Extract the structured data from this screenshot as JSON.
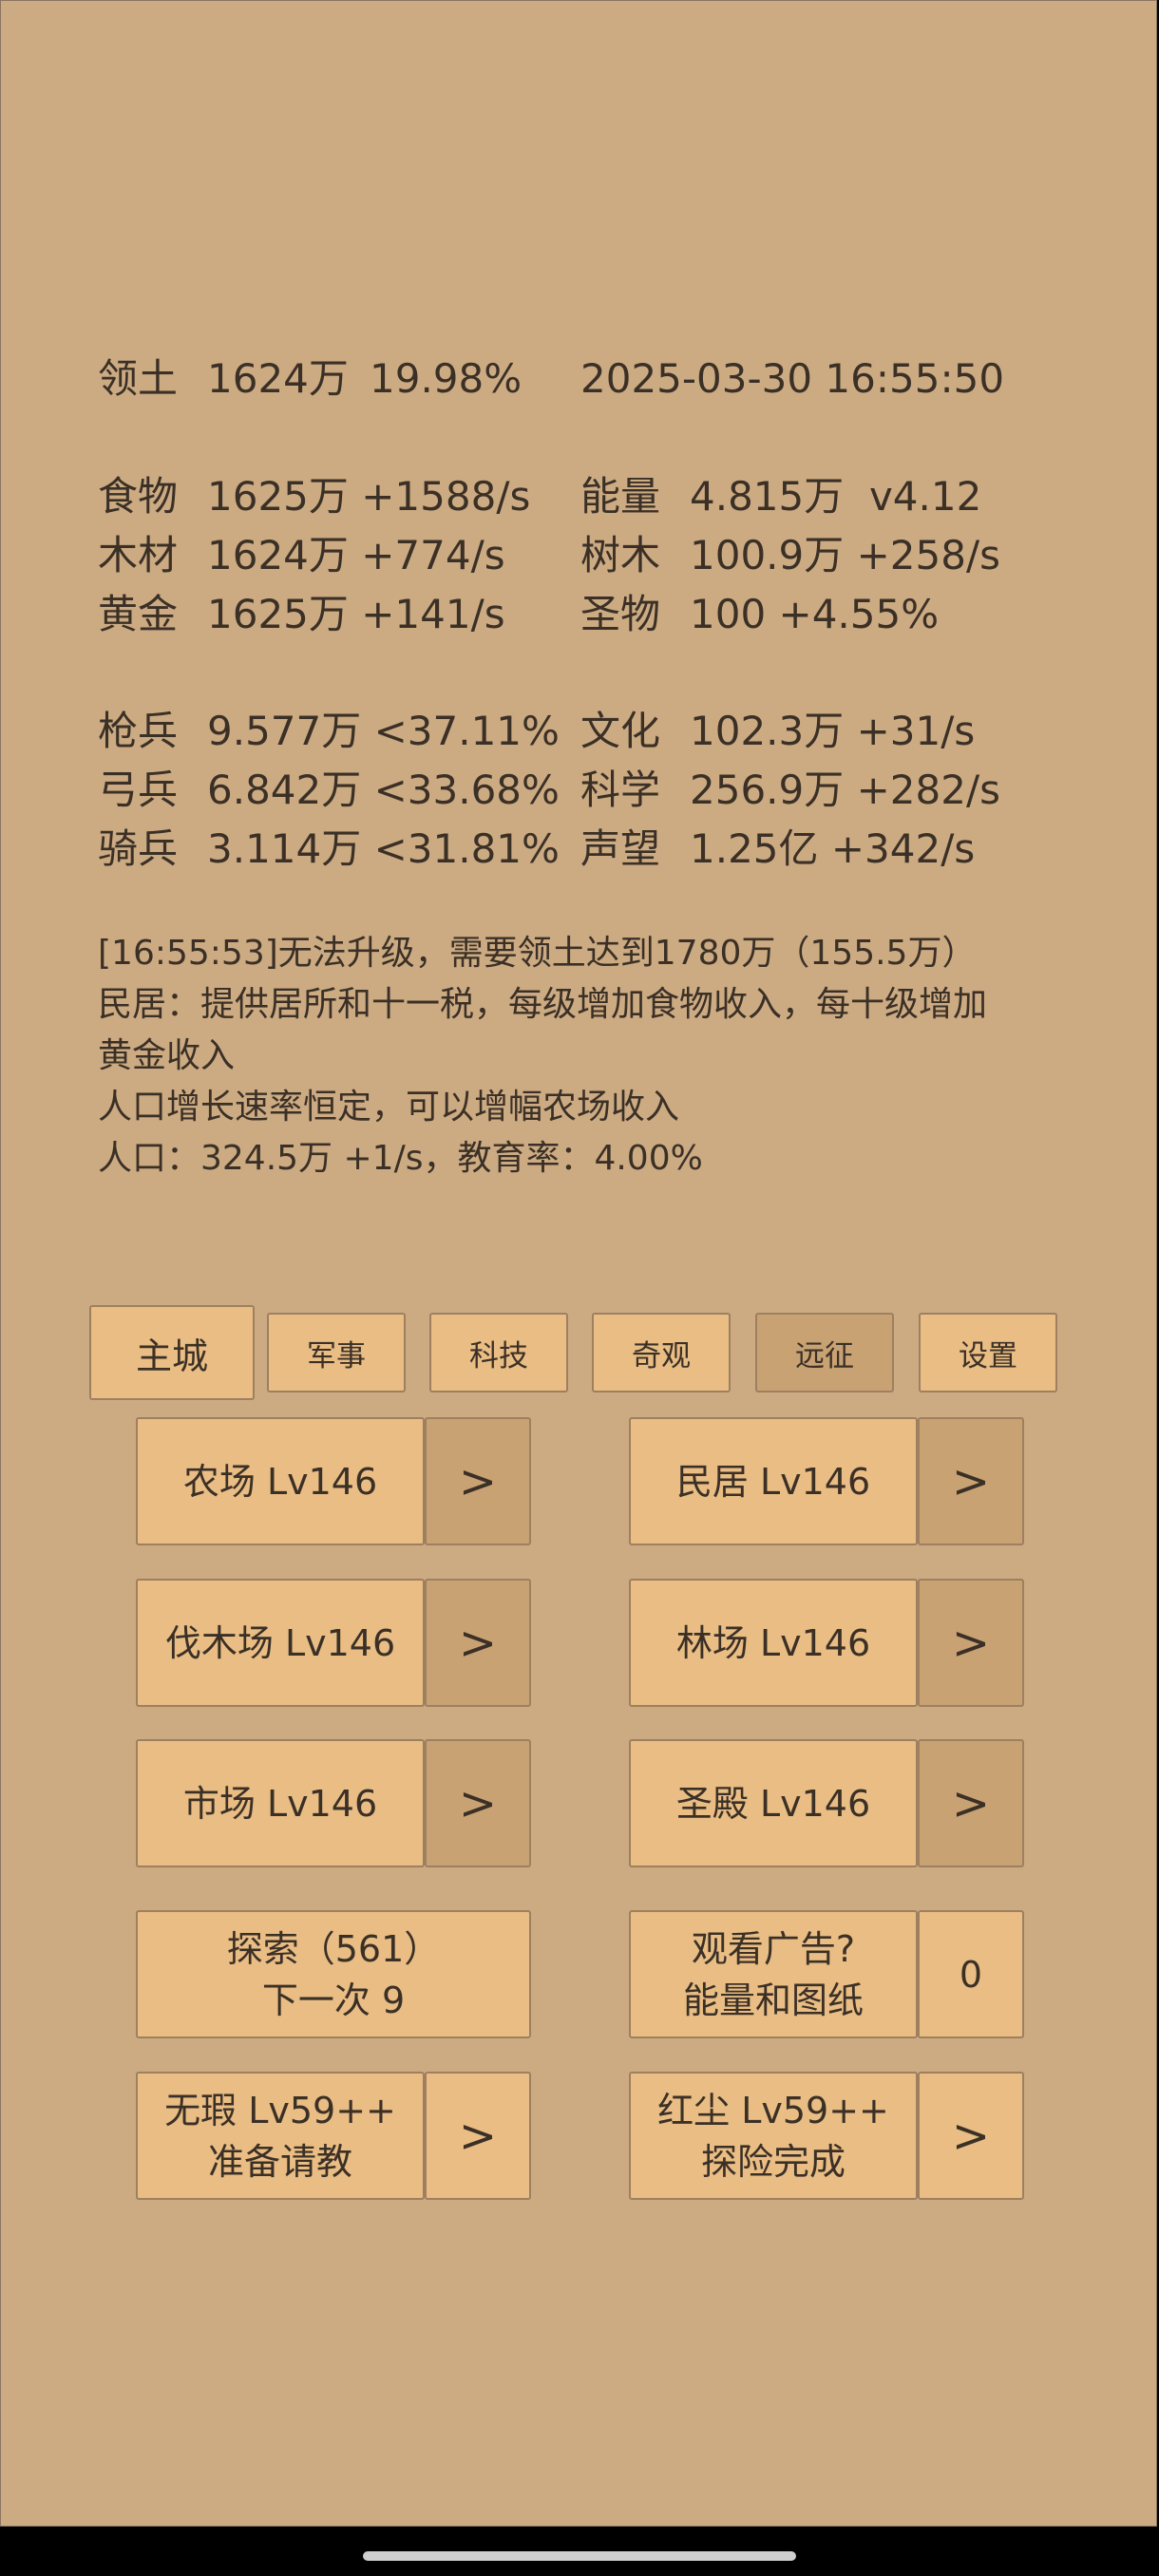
{
  "header": {
    "territory_label": "领土",
    "territory_value": "1624万",
    "territory_pct": "19.98%",
    "datetime": "2025-03-30 16:55:50"
  },
  "resources": {
    "food": {
      "label": "食物",
      "value": "1625万 +1588/s"
    },
    "wood": {
      "label": "木材",
      "value": "1624万 +774/s"
    },
    "gold": {
      "label": "黄金",
      "value": "1625万 +141/s"
    },
    "energy": {
      "label": "能量",
      "value": "4.815万  v4.12"
    },
    "trees": {
      "label": "树木",
      "value": "100.9万 +258/s"
    },
    "relic": {
      "label": "圣物",
      "value": "100 +4.55%"
    }
  },
  "military": {
    "spear": {
      "label": "枪兵",
      "value": "9.577万 <37.11%"
    },
    "archer": {
      "label": "弓兵",
      "value": "6.842万 <33.68%"
    },
    "cavalry": {
      "label": "骑兵",
      "value": "3.114万 <31.81%"
    },
    "culture": {
      "label": "文化",
      "value": "102.3万 +31/s"
    },
    "science": {
      "label": "科学",
      "value": "256.9万 +282/s"
    },
    "prestige": {
      "label": "声望",
      "value": "1.25亿 +342/s"
    }
  },
  "log": [
    "[16:55:53]无法升级，需要领土达到1780万（155.5万）",
    "民居：提供居所和十一税，每级增加食物收入，每十级增加",
    "黄金收入",
    "人口增长速率恒定，可以增幅农场收入",
    "人口：324.5万 +1/s，教育率：4.00%"
  ],
  "tabs": [
    "主城",
    "军事",
    "科技",
    "奇观",
    "远征",
    "设置"
  ],
  "buildings": {
    "farm": "农场 Lv146",
    "house": "民居 Lv146",
    "lumber": "伐木场 Lv146",
    "forest": "林场 Lv146",
    "market": "市场 Lv146",
    "temple": "圣殿 Lv146",
    "arrow": ">"
  },
  "explore": {
    "line1": "探索（561）",
    "line2": "下一次 9"
  },
  "ad": {
    "line1": "观看广告?",
    "line2": "能量和图纸",
    "count": "0"
  },
  "heroes": {
    "hero1": {
      "line1": "无瑕 Lv59++",
      "line2": "准备请教"
    },
    "hero2": {
      "line1": "红尘 Lv59++",
      "line2": "探险完成"
    }
  }
}
